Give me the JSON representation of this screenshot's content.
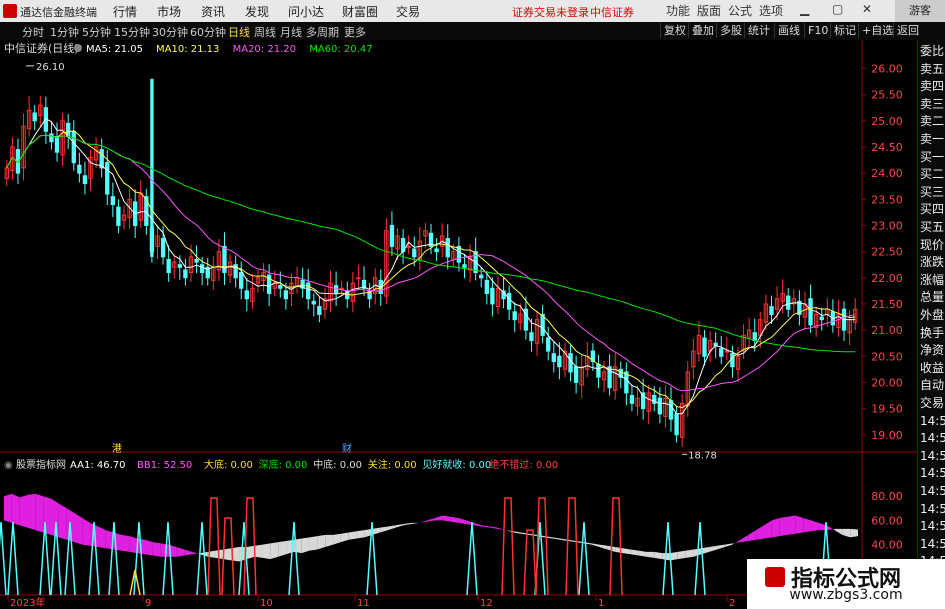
{
  "window": {
    "app_title": "通达信金融终端",
    "menu": [
      "行情",
      "市场",
      "资讯",
      "发现",
      "问小达",
      "财富圈",
      "交易"
    ],
    "notice": [
      "证券交易未登录",
      "中信证券"
    ],
    "win_buttons": [
      "功能",
      "版面",
      "公式",
      "选项"
    ],
    "guest_label": "游客"
  },
  "toolbar": {
    "periods": [
      "分时",
      "1分钟",
      "5分钟",
      "15分钟",
      "30分钟",
      "60分钟",
      "日线",
      "周线",
      "月线",
      "多周期",
      "更多"
    ],
    "active_period": "日线",
    "right_buttons": [
      "复权",
      "叠加",
      "多股",
      "统计",
      "画线",
      "F10",
      "标记",
      "+自选",
      "返回"
    ]
  },
  "right_panel": {
    "items": [
      "委比",
      "卖五",
      "卖四",
      "卖三",
      "卖二",
      "卖一",
      "买一",
      "买二",
      "买三",
      "买四",
      "买五",
      "现价",
      "涨跌",
      "涨幅",
      "总量",
      "外盘",
      "换手",
      "净资",
      "收益",
      "自动",
      "交易",
      "14:50",
      "14:50",
      "14:50",
      "14:50",
      "14:50",
      "14:50",
      "14:50",
      "14:50",
      "14:50"
    ]
  },
  "watermark": {
    "title": "指标公式网",
    "url": "www.zbgs3.com"
  },
  "colors": {
    "up": "#ff3232",
    "down": "#54ffff",
    "ma5": "#ffffff",
    "ma10": "#ffff54",
    "ma20": "#ff54ff",
    "ma60": "#00e600",
    "magenta_fill": "#e020e0",
    "gray_fill": "#d8d8d8"
  },
  "chart_data": [
    {
      "type": "candlestick",
      "title": "中信证券(日线)",
      "legend": [
        {
          "name": "MA5",
          "value": "21.05"
        },
        {
          "name": "MA10",
          "value": "21.13"
        },
        {
          "name": "MA20",
          "value": "21.20"
        },
        {
          "name": "MA60",
          "value": "20.47"
        }
      ],
      "yticks": [
        "26.00",
        "25.50",
        "25.00",
        "24.50",
        "24.00",
        "23.50",
        "23.00",
        "22.50",
        "22.00",
        "21.50",
        "21.00",
        "20.50",
        "20.00",
        "19.50",
        "19.00"
      ],
      "ylim": [
        18.9,
        26.2
      ],
      "high_label": "26.10",
      "low_label": "18.78",
      "markers": [
        "港",
        "财"
      ],
      "xticks": [
        "2023年",
        "9",
        "10",
        "11",
        "12",
        "1",
        "2"
      ],
      "closes": [
        24.1,
        24.5,
        24.0,
        24.9,
        25.2,
        25.0,
        25.3,
        24.8,
        24.6,
        24.4,
        25.0,
        24.7,
        24.2,
        24.0,
        23.8,
        24.3,
        24.5,
        24.1,
        23.6,
        23.4,
        23.0,
        23.2,
        23.5,
        23.0,
        23.6,
        23.0,
        22.5,
        22.8,
        22.4,
        22.1,
        22.3,
        22.2,
        22.0,
        22.4,
        22.3,
        22.1,
        22.0,
        22.2,
        22.5,
        22.1,
        22.3,
        22.0,
        21.8,
        21.6,
        21.8,
        22.0,
        22.1,
        21.7,
        21.9,
        21.8,
        21.6,
        21.9,
        22.0,
        21.8,
        21.6,
        21.5,
        21.3,
        21.6,
        21.9,
        21.7,
        21.8,
        21.6,
        21.9,
        22.0,
        21.8,
        21.6,
        22.0,
        21.7,
        22.9,
        22.6,
        22.8,
        22.5,
        22.6,
        22.4,
        22.7,
        22.9,
        22.6,
        22.5,
        22.8,
        22.4,
        22.5,
        22.3,
        22.2,
        22.4,
        22.1,
        22.0,
        21.7,
        21.5,
        21.8,
        21.6,
        21.4,
        21.2,
        21.3,
        21.0,
        20.8,
        21.2,
        20.9,
        20.6,
        20.4,
        20.3,
        20.6,
        20.2,
        20.0,
        20.3,
        20.5,
        20.4,
        20.1,
        20.2,
        19.9,
        20.3,
        20.1,
        19.8,
        19.6,
        19.7,
        19.5,
        19.8,
        19.6,
        19.4,
        19.7,
        19.3,
        19.0,
        19.6,
        20.2,
        20.6,
        20.9,
        20.5,
        20.8,
        20.7,
        20.5,
        20.6,
        20.3,
        20.5,
        20.9,
        21.0,
        20.8,
        21.2,
        21.5,
        21.3,
        21.6,
        21.7,
        21.4,
        21.6,
        21.3,
        21.5,
        21.1,
        21.3,
        21.2,
        21.4,
        21.1,
        21.3,
        21.0,
        21.2,
        21.4
      ]
    },
    {
      "type": "area",
      "title": "股票指标网",
      "legend": [
        {
          "name": "AA1",
          "value": "46.70"
        },
        {
          "name": "BB1",
          "value": "52.50"
        },
        {
          "name": "大底",
          "value": "0.00"
        },
        {
          "name": "深底",
          "value": "0.00"
        },
        {
          "name": "中底",
          "value": "0.00"
        },
        {
          "name": "关注",
          "value": "0.00"
        },
        {
          "name": "见好就收",
          "value": "0.00"
        },
        {
          "name": "绝不错过",
          "value": "0.00"
        }
      ],
      "yticks": [
        "80.00",
        "60.00",
        "40.00"
      ],
      "ylim": [
        0,
        100
      ],
      "aa1": [
        80,
        82,
        79,
        81,
        82,
        80,
        78,
        74,
        70,
        66,
        62,
        58,
        55,
        52,
        50,
        48,
        47,
        45,
        44,
        42,
        41,
        40,
        38,
        36,
        34,
        32,
        30,
        29,
        28,
        27,
        26,
        28,
        30,
        29,
        28,
        30,
        32,
        34,
        33,
        35,
        36,
        38,
        40,
        42,
        44,
        45,
        46,
        48,
        50,
        52,
        54,
        56,
        57,
        58,
        60,
        62,
        64,
        63,
        62,
        60,
        58,
        56,
        55,
        54,
        52,
        50,
        49,
        48,
        47,
        46,
        45,
        44,
        43,
        42,
        41,
        40,
        38,
        36,
        34,
        33,
        32,
        31,
        30,
        29,
        28,
        27,
        28,
        29,
        30,
        32,
        34,
        36,
        38,
        40,
        44,
        48,
        52,
        56,
        60,
        62,
        63,
        64,
        62,
        60,
        58,
        56,
        52,
        48,
        46,
        47
      ],
      "bb1": [
        60,
        58,
        56,
        54,
        52,
        50,
        48,
        46,
        44,
        42,
        40,
        39,
        38,
        37,
        36,
        35,
        34,
        33,
        32,
        31,
        30,
        30,
        30,
        31,
        32,
        33,
        34,
        35,
        36,
        37,
        38,
        38,
        39,
        40,
        41,
        42,
        43,
        44,
        45,
        46,
        47,
        48,
        48,
        49,
        50,
        51,
        52,
        53,
        54,
        55,
        56,
        57,
        58,
        58,
        59,
        60,
        60,
        59,
        58,
        57,
        56,
        55,
        54,
        53,
        52,
        51,
        50,
        49,
        48,
        47,
        46,
        45,
        44,
        43,
        42,
        41,
        40,
        39,
        38,
        37,
        36,
        35,
        34,
        34,
        33,
        33,
        34,
        35,
        36,
        37,
        38,
        39,
        40,
        41,
        42,
        43,
        44,
        45,
        46,
        47,
        48,
        49,
        50,
        51,
        52,
        52,
        53,
        53,
        53,
        52.5
      ]
    }
  ]
}
